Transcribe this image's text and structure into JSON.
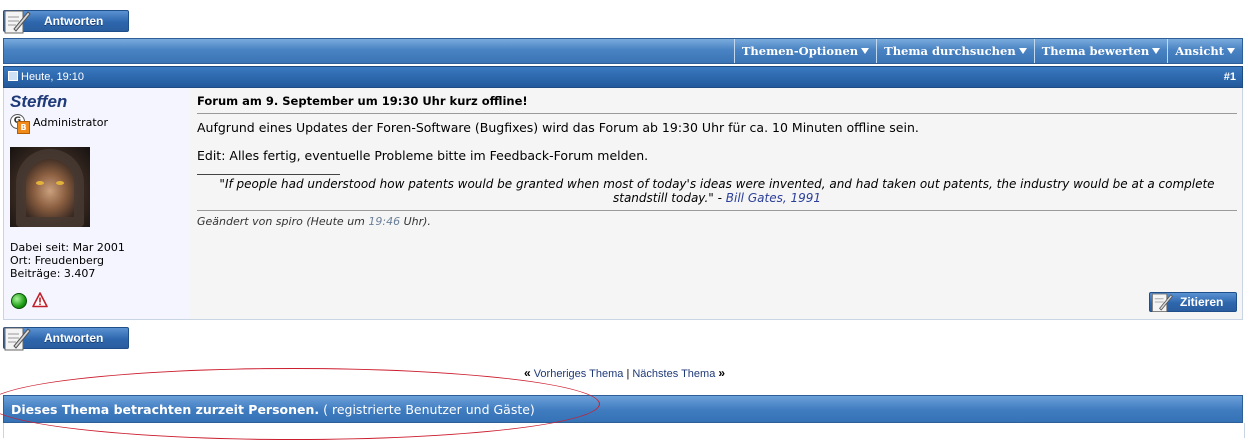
{
  "buttons": {
    "reply_label": "Antworten",
    "quote_label": "Zitieren"
  },
  "toolbar": {
    "items": [
      "Themen-Optionen",
      "Thema durchsuchen",
      "Thema bewerten",
      "Ansicht"
    ]
  },
  "post": {
    "date": "Heute, 19:10",
    "number": "#1",
    "user": {
      "name": "Steffen",
      "rank": "Administrator",
      "joined": "Dabei seit: Mar 2001",
      "location": "Ort: Freudenberg",
      "posts": "Beiträge: 3.407",
      "status": "online"
    },
    "title": "Forum am 9. September um 19:30 Uhr kurz offline!",
    "line1": "Aufgrund eines Updates der Foren-Software (Bugfixes) wird das Forum ab 19:30 Uhr für ca. 10 Minuten offline sein.",
    "line2": "Edit: Alles fertig, eventuelle Probleme bitte im Feedback-Forum melden.",
    "signature": {
      "quote": "\"If people had understood how patents would be granted when most of today's ideas were invented, and had taken out patents, the industry would be at a complete standstill today.\" - ",
      "author": "Bill Gates, 1991"
    },
    "edited": {
      "prefix": "Geändert von spiro (Heute um ",
      "time": "19:46",
      "suffix": " Uhr)."
    }
  },
  "nav": {
    "prev_marker": "«",
    "prev": "Vorheriges Thema",
    "sep": "|",
    "next": "Nächstes Thema",
    "next_marker": "»"
  },
  "viewers": {
    "bold": "Dieses Thema betrachten zurzeit Personen.",
    "rest": " ( registrierte Benutzer und Gäste)"
  },
  "colors": {
    "header_blue": "#3b74b6",
    "link_blue": "#1f3a78",
    "annotation_red": "#cc1d2e",
    "online_green": "#1d9e14"
  }
}
